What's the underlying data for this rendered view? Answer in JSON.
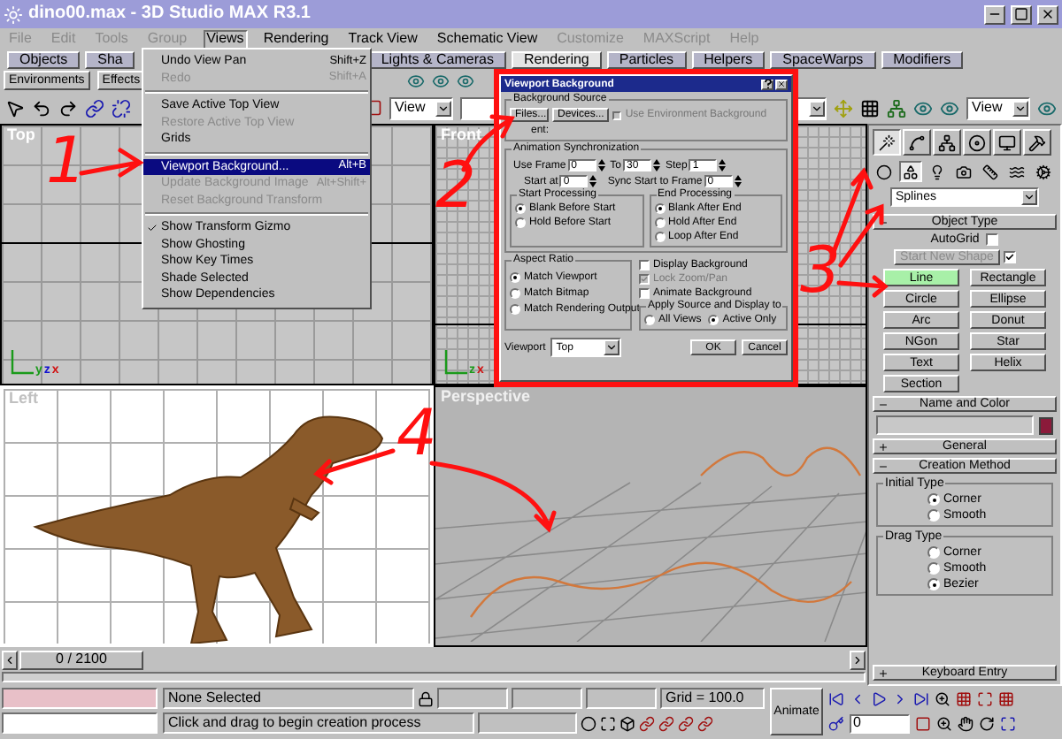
{
  "window": {
    "title": "dino00.max - 3D Studio MAX R3.1"
  },
  "menu": [
    {
      "label": "File",
      "disabled": true,
      "selected": false
    },
    {
      "label": "Edit",
      "disabled": true,
      "selected": false
    },
    {
      "label": "Tools",
      "disabled": true,
      "selected": false
    },
    {
      "label": "Group",
      "disabled": true,
      "selected": false
    },
    {
      "label": "Views",
      "disabled": false,
      "selected": true
    },
    {
      "label": "Rendering",
      "disabled": false,
      "selected": false
    },
    {
      "label": "Track View",
      "disabled": false,
      "selected": false
    },
    {
      "label": "Schematic View",
      "disabled": false,
      "selected": false
    },
    {
      "label": "Customize",
      "disabled": true,
      "selected": false
    },
    {
      "label": "MAXScript",
      "disabled": true,
      "selected": false
    },
    {
      "label": "Help",
      "disabled": true,
      "selected": false
    }
  ],
  "tabs": [
    {
      "label": "Objects",
      "selected": false
    },
    {
      "label": "Sha",
      "selected": false
    },
    {
      "label": "Lights & Cameras",
      "selected": false
    },
    {
      "label": "Rendering",
      "selected": true
    },
    {
      "label": "Particles",
      "selected": false
    },
    {
      "label": "Helpers",
      "selected": false
    },
    {
      "label": "SpaceWarps",
      "selected": false
    },
    {
      "label": "Modifiers",
      "selected": false
    }
  ],
  "tab_buttons": [
    "Environments",
    "Effects"
  ],
  "toolbar": {
    "view_dropdowns": [
      "View",
      "View"
    ]
  },
  "views_menu": [
    {
      "kind": "item",
      "label": "Undo View Pan",
      "shortcut": "Shift+Z",
      "disabled": false,
      "selected": false,
      "checked": false
    },
    {
      "kind": "item",
      "label": "Redo",
      "shortcut": "Shift+A",
      "disabled": true,
      "selected": false,
      "checked": false
    },
    {
      "kind": "separator"
    },
    {
      "kind": "item",
      "label": "Save Active Top View",
      "disabled": false,
      "selected": false,
      "checked": false
    },
    {
      "kind": "item",
      "label": "Restore Active Top View",
      "disabled": true,
      "selected": false,
      "checked": false
    },
    {
      "kind": "item",
      "label": "Grids",
      "disabled": false,
      "selected": false,
      "checked": false
    },
    {
      "kind": "separator"
    },
    {
      "kind": "item",
      "label": "Viewport Background...",
      "shortcut": "Alt+B",
      "disabled": false,
      "selected": true,
      "checked": false
    },
    {
      "kind": "item",
      "label": "Update Background Image",
      "shortcut": "Alt+Shift+",
      "disabled": true,
      "selected": false,
      "checked": false
    },
    {
      "kind": "item",
      "label": "Reset Background Transform",
      "disabled": true,
      "selected": false,
      "checked": false
    },
    {
      "kind": "separator"
    },
    {
      "kind": "item",
      "label": "Show Transform Gizmo",
      "disabled": false,
      "selected": false,
      "checked": true
    },
    {
      "kind": "item",
      "label": "Show Ghosting",
      "disabled": false,
      "selected": false,
      "checked": false
    },
    {
      "kind": "item",
      "label": "Show Key Times",
      "disabled": false,
      "selected": false,
      "checked": false
    },
    {
      "kind": "item",
      "label": "Shade Selected",
      "disabled": false,
      "selected": false,
      "checked": false
    },
    {
      "kind": "item",
      "label": "Show Dependencies",
      "disabled": false,
      "selected": false,
      "checked": false
    }
  ],
  "viewports": [
    {
      "label": "Top",
      "kind": "grid",
      "active": false,
      "axes": [
        "y",
        "z",
        "x"
      ]
    },
    {
      "label": "Front",
      "kind": "fine-grid",
      "active": false,
      "axes": [
        "z",
        "x"
      ]
    },
    {
      "label": "Left",
      "kind": "image",
      "active": true
    },
    {
      "label": "Perspective",
      "kind": "perspective",
      "active": false
    }
  ],
  "dialog": {
    "title": "Viewport Background",
    "source": {
      "label": "Background Source",
      "buttons": [
        "Files...",
        "Devices..."
      ],
      "use_env": {
        "label": "Use Environment Background",
        "checked": false,
        "disabled": true
      },
      "current": "ent:"
    },
    "sync": {
      "label": "Animation Synchronization",
      "use_frame": {
        "label": "Use Frame",
        "value": "0"
      },
      "to": {
        "label": "To",
        "value": "30"
      },
      "step": {
        "label": "Step",
        "value": "1"
      },
      "start_at": {
        "label": "Start at",
        "value": "0"
      },
      "sync_start": {
        "label": "Sync Start to Frame",
        "value": "0"
      },
      "start": {
        "label": "Start Processing",
        "options": [
          {
            "label": "Blank Before Start",
            "selected": true
          },
          {
            "label": "Hold Before Start",
            "selected": false
          }
        ]
      },
      "end": {
        "label": "End Processing",
        "options": [
          {
            "label": "Blank After End",
            "selected": true
          },
          {
            "label": "Hold After End",
            "selected": false
          },
          {
            "label": "Loop After End",
            "selected": false
          }
        ]
      }
    },
    "aspect": {
      "label": "Aspect Ratio",
      "options": [
        {
          "label": "Match Viewport",
          "selected": true
        },
        {
          "label": "Match Bitmap",
          "selected": false
        },
        {
          "label": "Match Rendering Output",
          "selected": false
        }
      ]
    },
    "checks": [
      {
        "label": "Display Background",
        "checked": false,
        "disabled": false
      },
      {
        "label": "Lock Zoom/Pan",
        "checked": true,
        "disabled": true
      },
      {
        "label": "Animate Background",
        "checked": false,
        "disabled": false
      }
    ],
    "apply": {
      "label": "Apply Source and Display to",
      "options": [
        {
          "label": "All Views",
          "selected": false
        },
        {
          "label": "Active Only",
          "selected": true
        }
      ]
    },
    "viewport": {
      "label": "Viewport",
      "value": "Top"
    },
    "buttons": [
      "OK",
      "Cancel"
    ]
  },
  "command_panel": {
    "tabs": [
      {
        "selected": true
      },
      {
        "selected": false
      },
      {
        "selected": false
      },
      {
        "selected": false
      },
      {
        "selected": false
      },
      {
        "selected": false
      }
    ],
    "categories": [
      {
        "selected": false
      },
      {
        "selected": true
      },
      {
        "selected": false
      },
      {
        "selected": false
      },
      {
        "selected": false
      },
      {
        "selected": false
      },
      {
        "selected": false
      }
    ],
    "dropdown": "Splines",
    "object_type": {
      "title": "Object Type",
      "expanded": true,
      "autogrid": {
        "label": "AutoGrid",
        "checked": false
      },
      "start_new_shape": {
        "label": "Start New Shape",
        "disabled": true,
        "checked": true
      },
      "buttons": [
        {
          "label": "Line",
          "selected": true
        },
        {
          "label": "Rectangle",
          "selected": false
        },
        {
          "label": "Circle",
          "selected": false
        },
        {
          "label": "Ellipse",
          "selected": false
        },
        {
          "label": "Arc",
          "selected": false
        },
        {
          "label": "Donut",
          "selected": false
        },
        {
          "label": "NGon",
          "selected": false
        },
        {
          "label": "Star",
          "selected": false
        },
        {
          "label": "Text",
          "selected": false
        },
        {
          "label": "Helix",
          "selected": false
        },
        {
          "label": "Section",
          "selected": false
        }
      ]
    },
    "name_and_color": {
      "title": "Name and Color",
      "expanded": true,
      "color": "#8b1a3a"
    },
    "general": {
      "title": "General",
      "expanded": false
    },
    "creation_method": {
      "title": "Creation Method",
      "expanded": true,
      "groups": [
        {
          "label": "Initial Type",
          "options": [
            {
              "label": "Corner",
              "selected": true
            },
            {
              "label": "Smooth",
              "selected": false
            }
          ]
        },
        {
          "label": "Drag Type",
          "options": [
            {
              "label": "Corner",
              "selected": false
            },
            {
              "label": "Smooth",
              "selected": false
            },
            {
              "label": "Bezier",
              "selected": true
            }
          ]
        }
      ]
    },
    "keyboard_entry": {
      "title": "Keyboard Entry",
      "expanded": false
    }
  },
  "time_slider": {
    "label": "0 / 2100",
    "level": 0
  },
  "status": {
    "selection": "None Selected",
    "grid": "Grid = 100.0",
    "prompt": "Click and drag to begin creation process",
    "animate": {
      "label": "Animate",
      "on": false
    },
    "frame": "0"
  },
  "annotations": [
    "1",
    "2",
    "3",
    "4"
  ]
}
